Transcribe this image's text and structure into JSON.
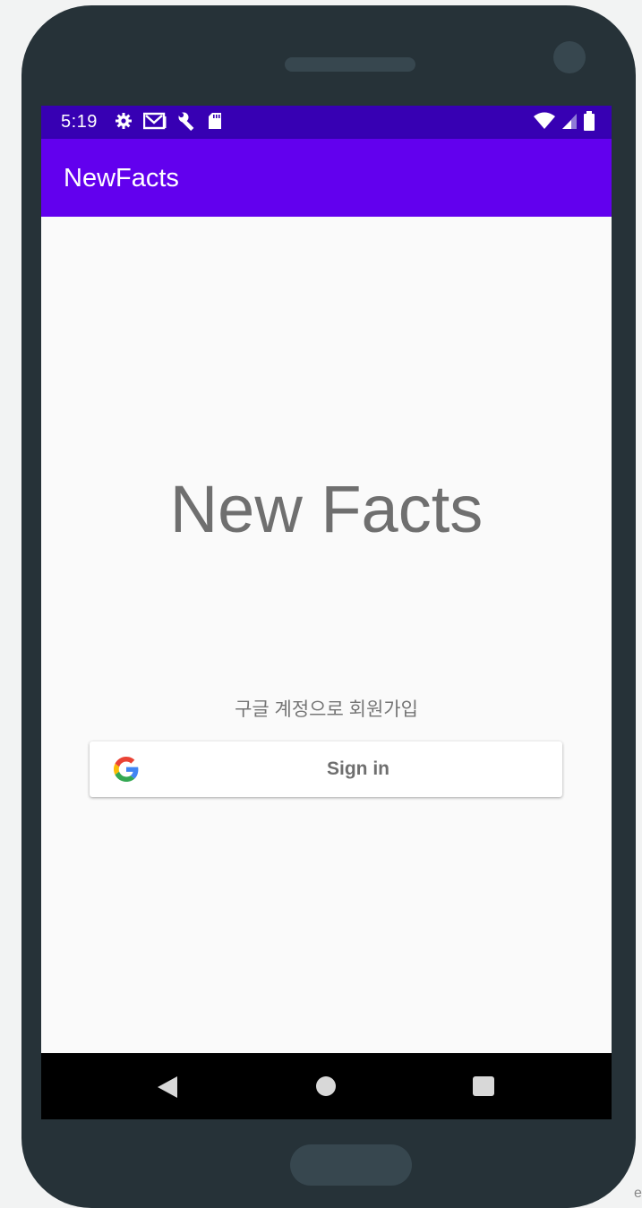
{
  "status_bar": {
    "time": "5:19",
    "left_icons": [
      "gear-icon",
      "gmail-icon",
      "wrench-icon",
      "sd-card-icon"
    ],
    "right_icons": [
      "wifi-icon",
      "cell-signal-icon",
      "battery-icon"
    ],
    "color": "#3700b3"
  },
  "app_bar": {
    "title": "NewFacts",
    "color": "#6200ee"
  },
  "main": {
    "headline": "New Facts",
    "signup_hint": "구글 계정으로 회원가입",
    "sign_in_button": {
      "label": "Sign in",
      "icon": "google-g-icon"
    }
  },
  "nav_bar": {
    "buttons": [
      "back-icon",
      "home-icon",
      "recents-icon"
    ]
  },
  "edge_text": "e"
}
